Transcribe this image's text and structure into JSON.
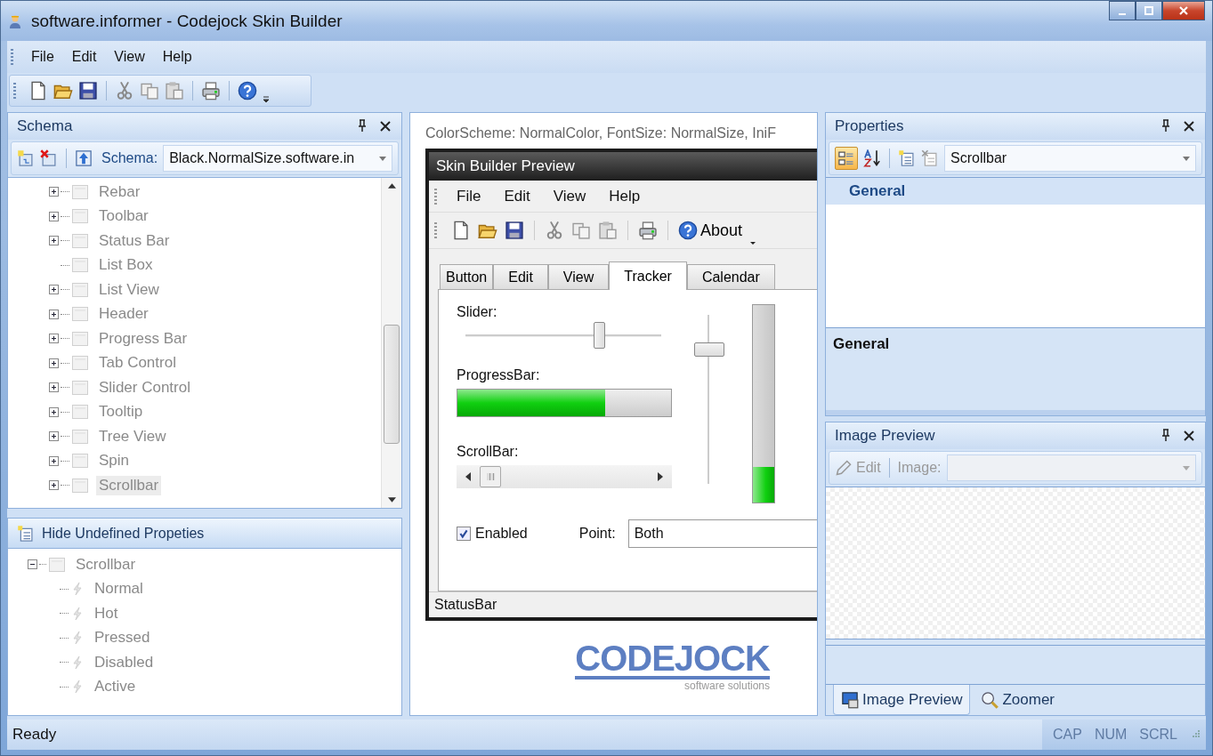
{
  "window": {
    "title": "software.informer - Codejock Skin Builder"
  },
  "menu": [
    "File",
    "Edit",
    "View",
    "Help"
  ],
  "schema_panel": {
    "title": "Schema",
    "schema_label": "Schema:",
    "schema_value": "Black.NormalSize.software.in",
    "tree": [
      {
        "label": "Rebar",
        "expandable": true,
        "selected": false
      },
      {
        "label": "Toolbar",
        "expandable": true,
        "selected": false
      },
      {
        "label": "Status Bar",
        "expandable": true,
        "selected": false
      },
      {
        "label": "List Box",
        "expandable": false,
        "selected": false
      },
      {
        "label": "List View",
        "expandable": true,
        "selected": false
      },
      {
        "label": "Header",
        "expandable": true,
        "selected": false
      },
      {
        "label": "Progress Bar",
        "expandable": true,
        "selected": false
      },
      {
        "label": "Tab Control",
        "expandable": true,
        "selected": false
      },
      {
        "label": "Slider Control",
        "expandable": true,
        "selected": false
      },
      {
        "label": "Tooltip",
        "expandable": true,
        "selected": false
      },
      {
        "label": "Tree View",
        "expandable": true,
        "selected": false
      },
      {
        "label": "Spin",
        "expandable": true,
        "selected": false
      },
      {
        "label": "Scrollbar",
        "expandable": true,
        "selected": true
      }
    ]
  },
  "states_panel": {
    "button": "Hide Undefined Propeties",
    "tree": [
      {
        "label": "Scrollbar",
        "expanded": true,
        "children": [
          {
            "label": "Normal"
          },
          {
            "label": "Hot"
          },
          {
            "label": "Pressed"
          },
          {
            "label": "Disabled"
          },
          {
            "label": "Active"
          }
        ]
      }
    ]
  },
  "preview": {
    "info": "ColorScheme: NormalColor, FontSize: NormalSize, IniF",
    "window_title": "Skin Builder Preview",
    "menu": [
      "File",
      "Edit",
      "View",
      "Help"
    ],
    "about": "About",
    "tabs": [
      {
        "label": "Button",
        "selected": false
      },
      {
        "label": "Edit",
        "selected": false
      },
      {
        "label": "View",
        "selected": false
      },
      {
        "label": "Tracker",
        "selected": true
      },
      {
        "label": "Calendar",
        "selected": false
      }
    ],
    "slider_label": "Slider:",
    "slider": {
      "level": 0.68
    },
    "vertical_slider": {
      "level": 0.8
    },
    "progress_label": "ProgressBar:",
    "progress": {
      "level": 0.69
    },
    "vertical_progress": {
      "level": 0.18
    },
    "scrollbar_label": "ScrollBar:",
    "enabled": {
      "label": "Enabled",
      "checked": true
    },
    "point_label": "Point:",
    "point_value": "Both",
    "status": "StatusBar"
  },
  "logo": {
    "name": "CODEJOCK",
    "tagline": "software solutions"
  },
  "properties": {
    "title": "Properties",
    "object": "Scrollbar",
    "category": "General",
    "description_title": "General"
  },
  "image_preview": {
    "title": "Image Preview",
    "edit": "Edit",
    "image_label": "Image:",
    "toolbar_disabled": true,
    "tabs": [
      {
        "label": "Image Preview",
        "selected": true
      },
      {
        "label": "Zoomer",
        "selected": false
      }
    ]
  },
  "status_bar": {
    "text": "Ready",
    "indicators": [
      {
        "label": "CAP",
        "on": false
      },
      {
        "label": "NUM",
        "on": false
      },
      {
        "label": "SCRL",
        "on": false
      }
    ]
  }
}
